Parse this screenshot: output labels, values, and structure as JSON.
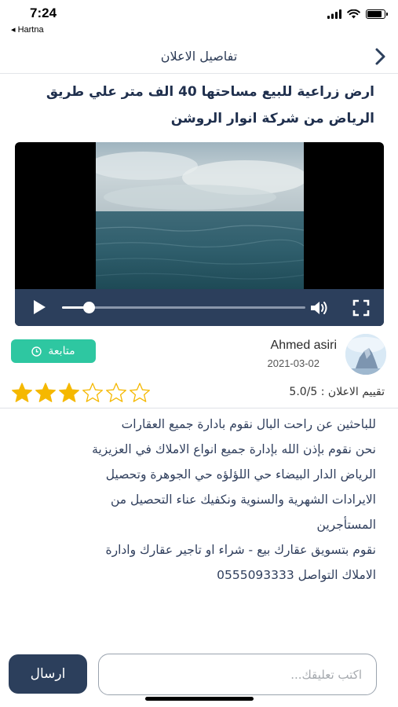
{
  "status_bar": {
    "time": "7:24",
    "back_app": "◂ Hartna",
    "battery_level": 0.85
  },
  "nav": {
    "title": "تفاصيل الاعلان",
    "back_icon": "chevron-right-icon"
  },
  "ad": {
    "title": "ارض زراعية للبيع مساحتها 40 الف متر علي طريق الرياض من شركة انوار الروشن"
  },
  "video": {
    "progress": 0.11,
    "icons": [
      "play-icon",
      "volume-icon",
      "fullscreen-icon"
    ]
  },
  "author": {
    "name": "Ahmed asiri",
    "date": "2021-03-02",
    "follow_label": "متابعة",
    "follow_icon": "clock-icon"
  },
  "rating": {
    "label": "تقييم الاعلان : 5.0/5",
    "stars_filled": 3,
    "stars_total": 6,
    "star_color": "#f5b800"
  },
  "description": {
    "lines": [
      "للباحثين عن راحت البال نقوم بادارة جميع العقارات",
      "نحن نقوم بإذن الله بإدارة جميع انواع الاملاك في العزيزية",
      "الرياض الدار البيضاء حي اللؤلؤه حي الجوهرة وتحصيل",
      "الايرادات الشهرية والسنوية ونكفيك عناء التحصيل من",
      "المستأجرين",
      "نقوم بتسويق عقارك بيع - شراء او تاجير عقارك وادارة",
      "الاملاك التواصل 0555093333"
    ]
  },
  "comment": {
    "placeholder": "اكتب تعليقك...",
    "value": "",
    "send_label": "ارسال"
  },
  "colors": {
    "primary": "#2c3f5c",
    "accent": "#2ec7a1"
  }
}
